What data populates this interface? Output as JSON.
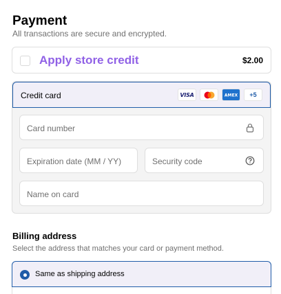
{
  "payment": {
    "title": "Payment",
    "subtitle": "All transactions are secure and encrypted."
  },
  "store_credit": {
    "label": "Apply store credit",
    "amount": "$2.00",
    "checked": false,
    "accent_color": "#9061e6"
  },
  "credit_card": {
    "label": "Credit card",
    "card_brands": [
      {
        "name": "Visa",
        "icon": "visa-icon",
        "text": "VISA"
      },
      {
        "name": "Mastercard",
        "icon": "mastercard-icon"
      },
      {
        "name": "American Express",
        "icon": "amex-icon",
        "text": "AMEX"
      }
    ],
    "more_brands": "+5",
    "fields": {
      "card_number": {
        "placeholder": "Card number",
        "icon": "lock-icon"
      },
      "expiration": {
        "placeholder": "Expiration date (MM / YY)"
      },
      "security_code": {
        "placeholder": "Security code",
        "icon": "help-circle-icon"
      },
      "name_on_card": {
        "placeholder": "Name on card"
      }
    }
  },
  "billing": {
    "title": "Billing address",
    "subtitle": "Select the address that matches your card or payment method.",
    "options": [
      {
        "label": "Same as shipping address",
        "selected": true
      }
    ]
  },
  "colors": {
    "selected_border": "#1f5ca8",
    "selected_bg": "#f1eff8",
    "muted_text": "#707070"
  }
}
